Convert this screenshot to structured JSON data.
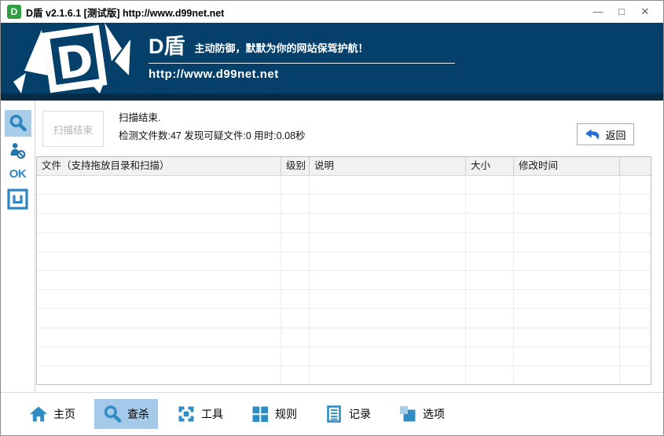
{
  "window": {
    "title": "D盾 v2.1.6.1 [测试版] http://www.d99net.net",
    "app_icon_letter": "D",
    "controls": {
      "minimize": "—",
      "maximize": "□",
      "close": "✕"
    }
  },
  "banner": {
    "logo_letter": "D",
    "brand": "D盾",
    "slogan": "主动防御，默默为你的网站保驾护航！",
    "url": "http://www.d99net.net"
  },
  "sidebar": {
    "items": [
      {
        "name": "scan",
        "icon": "search-icon",
        "active": true
      },
      {
        "name": "user-block",
        "icon": "user-block-icon",
        "active": false
      },
      {
        "name": "ok",
        "label": "OK",
        "active": false
      },
      {
        "name": "window-box",
        "icon": "window-box-icon",
        "active": false
      }
    ]
  },
  "scan_panel": {
    "scan_button": "扫描结束",
    "status_line1": "扫描结束.",
    "status_line2": "检测文件数:47 发现可疑文件:0 用时:0.08秒",
    "back_button": "返回"
  },
  "table": {
    "columns": [
      "文件（支持拖放目录和扫描）",
      "级别",
      "说明",
      "大小",
      "修改时间",
      ""
    ],
    "rows": [],
    "empty_row_count": 11
  },
  "toolbar": {
    "items": [
      {
        "label": "主页",
        "icon": "home-icon",
        "active": false
      },
      {
        "label": "查杀",
        "icon": "search-icon",
        "active": true
      },
      {
        "label": "工具",
        "icon": "tools-icon",
        "active": false
      },
      {
        "label": "规则",
        "icon": "rules-icon",
        "active": false
      },
      {
        "label": "记录",
        "icon": "log-icon",
        "active": false
      },
      {
        "label": "选项",
        "icon": "options-icon",
        "active": false
      }
    ]
  },
  "colors": {
    "banner_bg": "#04406a",
    "banner_bg_dark": "#082c43",
    "accent_blue": "#2e86c1",
    "toolbar_icon_blue": "#2f8dc3",
    "highlight_bg": "#a9cde9",
    "back_arrow_blue": "#2a6fd4",
    "title_icon_green": "#2f9e44"
  }
}
